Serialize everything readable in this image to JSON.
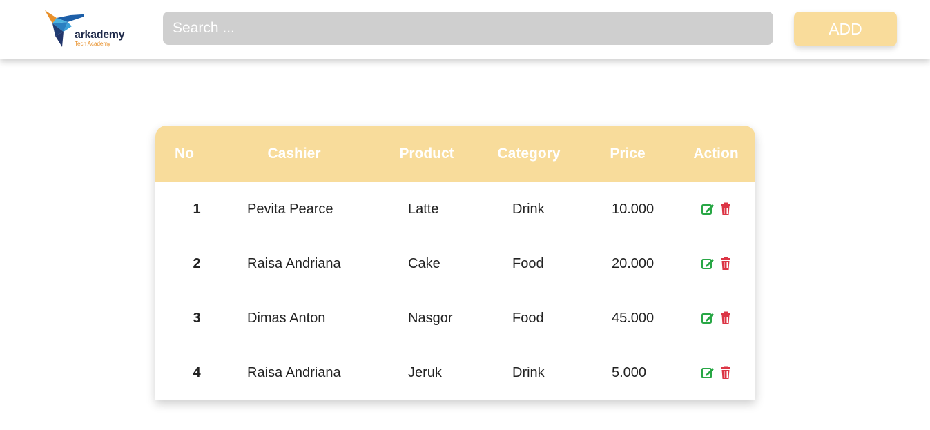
{
  "header": {
    "logo_text": "arkademy",
    "logo_subtext": "Tech Academy",
    "search_placeholder": "Search ...",
    "add_label": "ADD"
  },
  "table": {
    "columns": [
      "No",
      "Cashier",
      "Product",
      "Category",
      "Price",
      "Action"
    ],
    "rows": [
      {
        "no": "1",
        "cashier": "Pevita Pearce",
        "product": "Latte",
        "category": "Drink",
        "price": "10.000"
      },
      {
        "no": "2",
        "cashier": "Raisa Andriana",
        "product": "Cake",
        "category": "Food",
        "price": "20.000"
      },
      {
        "no": "3",
        "cashier": "Dimas Anton",
        "product": "Nasgor",
        "category": "Food",
        "price": "45.000"
      },
      {
        "no": "4",
        "cashier": "Raisa Andriana",
        "product": "Jeruk",
        "category": "Drink",
        "price": "5.000"
      }
    ]
  },
  "colors": {
    "accent": "#f8dc9b",
    "edit": "#28a745",
    "delete": "#dc3545"
  },
  "icons": {
    "edit": "edit-icon",
    "delete": "trash-icon"
  }
}
